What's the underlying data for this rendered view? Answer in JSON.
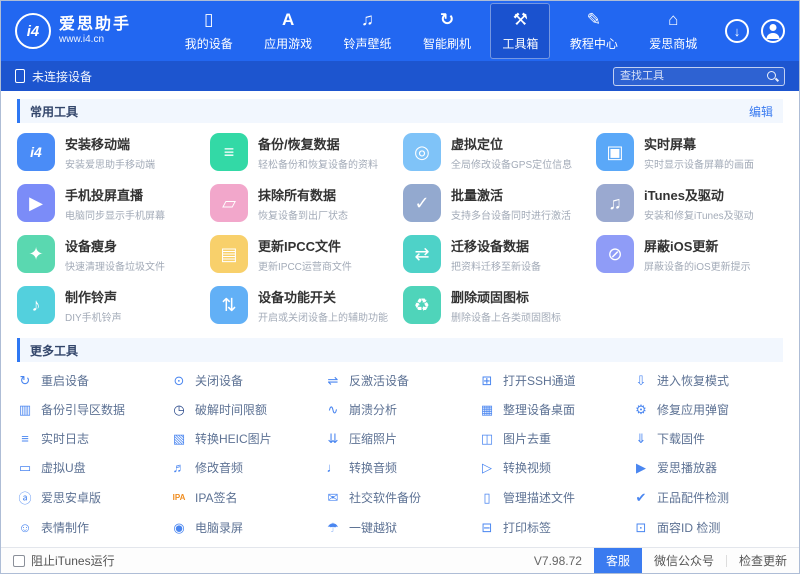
{
  "topbar": {
    "logo": {
      "badge": "i4",
      "title": "爱思助手",
      "url": "www.i4.cn"
    },
    "nav_items": [
      {
        "label": "我的设备",
        "icon": "nav-device"
      },
      {
        "label": "应用游戏",
        "icon": "nav-apps"
      },
      {
        "label": "铃声壁纸",
        "icon": "nav-ringtone"
      },
      {
        "label": "智能刷机",
        "icon": "nav-flash"
      },
      {
        "label": "工具箱",
        "icon": "nav-toolbox",
        "active": true
      },
      {
        "label": "教程中心",
        "icon": "nav-tutorial"
      },
      {
        "label": "爱思商城",
        "icon": "nav-mall"
      }
    ]
  },
  "device_bar": {
    "status": "未连接设备",
    "search_placeholder": "查找工具"
  },
  "sections": {
    "common": {
      "title": "常用工具",
      "edit_label": "编辑",
      "tools": [
        {
          "title": "安装移动端",
          "desc": "安装爱思助手移动端",
          "icon": "i4-mobile",
          "color": "#4a8cf7"
        },
        {
          "title": "备份/恢复数据",
          "desc": "轻松备份和恢复设备的资料",
          "icon": "backup-layers",
          "color": "#33d9a6"
        },
        {
          "title": "虚拟定位",
          "desc": "全局修改设备GPS定位信息",
          "icon": "location-pin",
          "color": "#7fc3f8"
        },
        {
          "title": "实时屏幕",
          "desc": "实时显示设备屏幕的画面",
          "icon": "screen",
          "color": "#5aa8f8"
        },
        {
          "title": "手机投屏直播",
          "desc": "电脑同步显示手机屏幕",
          "icon": "screencast-play",
          "color": "#7b8cf8"
        },
        {
          "title": "抹除所有数据",
          "desc": "恢复设备到出厂状态",
          "icon": "eraser",
          "color": "#f2a7cb"
        },
        {
          "title": "批量激活",
          "desc": "支持多台设备同时进行激活",
          "icon": "batch-activate",
          "color": "#93a9cf"
        },
        {
          "title": "iTunes及驱动",
          "desc": "安装和修复iTunes及驱动",
          "icon": "itunes-note",
          "color": "#9aa9d0"
        },
        {
          "title": "设备瘦身",
          "desc": "快速清理设备垃圾文件",
          "icon": "clean-broom",
          "color": "#5ad8b0"
        },
        {
          "title": "更新IPCC文件",
          "desc": "更新IPCC运营商文件",
          "icon": "ipcc-file",
          "color": "#f8d06b"
        },
        {
          "title": "迁移设备数据",
          "desc": "把资料迁移至新设备",
          "icon": "migrate-arrows",
          "color": "#4ed2c8"
        },
        {
          "title": "屏蔽iOS更新",
          "desc": "屏蔽设备的iOS更新提示",
          "icon": "block-update",
          "color": "#8f9cf7"
        },
        {
          "title": "制作铃声",
          "desc": "DIY手机铃声",
          "icon": "ringtone-note",
          "color": "#53d0dd"
        },
        {
          "title": "设备功能开关",
          "desc": "开启或关闭设备上的辅助功能",
          "icon": "switches",
          "color": "#62b0f6"
        },
        {
          "title": "删除顽固图标",
          "desc": "删除设备上各类顽固图标",
          "icon": "trash",
          "color": "#4fd4ba"
        }
      ]
    },
    "more": {
      "title": "更多工具",
      "tools": [
        {
          "label": "重启设备",
          "icon": "restart"
        },
        {
          "label": "关闭设备",
          "icon": "power"
        },
        {
          "label": "反激活设备",
          "icon": "deactivate"
        },
        {
          "label": "打开SSH通道",
          "icon": "ssh"
        },
        {
          "label": "进入恢复模式",
          "icon": "recovery"
        },
        {
          "label": "备份引导区数据",
          "icon": "boot-backup"
        },
        {
          "label": "破解时间限额",
          "icon": "time-crack"
        },
        {
          "label": "崩溃分析",
          "icon": "crash-analysis"
        },
        {
          "label": "整理设备桌面",
          "icon": "organize-desktop"
        },
        {
          "label": "修复应用弹窗",
          "icon": "fix-popup"
        },
        {
          "label": "实时日志",
          "icon": "logs"
        },
        {
          "label": "转换HEIC图片",
          "icon": "heic-convert"
        },
        {
          "label": "压缩照片",
          "icon": "compress-photo"
        },
        {
          "label": "图片去重",
          "icon": "image-dedupe"
        },
        {
          "label": "下载固件",
          "icon": "firmware-download"
        },
        {
          "label": "虚拟U盘",
          "icon": "virtual-usb"
        },
        {
          "label": "修改音频",
          "icon": "audio-edit"
        },
        {
          "label": "转换音频",
          "icon": "audio-convert"
        },
        {
          "label": "转换视频",
          "icon": "video-convert"
        },
        {
          "label": "爱思播放器",
          "icon": "player"
        },
        {
          "label": "爱思安卓版",
          "icon": "android"
        },
        {
          "label": "IPA签名",
          "icon": "ipa-sign"
        },
        {
          "label": "社交软件备份",
          "icon": "social-backup"
        },
        {
          "label": "管理描述文件",
          "icon": "profiles"
        },
        {
          "label": "正品配件检测",
          "icon": "accessory-check"
        },
        {
          "label": "表情制作",
          "icon": "emoji-maker"
        },
        {
          "label": "电脑录屏",
          "icon": "screen-record"
        },
        {
          "label": "一键越狱",
          "icon": "jailbreak"
        },
        {
          "label": "打印标签",
          "icon": "print-label"
        },
        {
          "label": "面容ID 检测",
          "icon": "faceid-check"
        }
      ]
    }
  },
  "status_bar": {
    "checkbox_label": "阻止iTunes运行",
    "version": "V7.98.72",
    "service_label": "客服",
    "wechat_label": "微信公众号",
    "update_label": "检查更新"
  },
  "colors": {
    "topbar": "#2267f1",
    "devicebar": "#1d55cf",
    "accent": "#2f78f3",
    "edit_link": "#3a7bf0",
    "more_icon_default": "#4a86f0",
    "ipa_icon": "#f08c1e",
    "service_badge": "#3a7bf0"
  },
  "glyphs": {
    "nav-device": "▯",
    "nav-apps": "A",
    "nav-ringtone": "♫",
    "nav-flash": "↻",
    "nav-toolbox": "⚒",
    "nav-tutorial": "✎",
    "nav-mall": "⌂",
    "download-icon": "↓",
    "i4-mobile": "i4",
    "backup-layers": "≡",
    "location-pin": "◎",
    "screen": "▣",
    "screencast-play": "▶",
    "eraser": "▱",
    "batch-activate": "✓",
    "itunes-note": "♫",
    "clean-broom": "✦",
    "ipcc-file": "▤",
    "migrate-arrows": "⇄",
    "block-update": "⊘",
    "ringtone-note": "♪",
    "switches": "⇅",
    "trash": "♻",
    "restart": "↻",
    "power": "⊙",
    "deactivate": "⇌",
    "ssh": "⊞",
    "recovery": "⇩",
    "boot-backup": "▥",
    "time-crack": "◷",
    "crash-analysis": "∿",
    "organize-desktop": "▦",
    "fix-popup": "⚙",
    "logs": "≡",
    "heic-convert": "▧",
    "compress-photo": "⇊",
    "image-dedupe": "◫",
    "firmware-download": "⇓",
    "virtual-usb": "▭",
    "audio-edit": "♬",
    "audio-convert": "♩",
    "video-convert": "▷",
    "player": "▶",
    "android": "ⓐ",
    "ipa-sign": "IPA",
    "social-backup": "✉",
    "profiles": "▯",
    "accessory-check": "✔",
    "emoji-maker": "☺",
    "screen-record": "◉",
    "jailbreak": "☂",
    "print-label": "⊟",
    "faceid-check": "⊡"
  }
}
